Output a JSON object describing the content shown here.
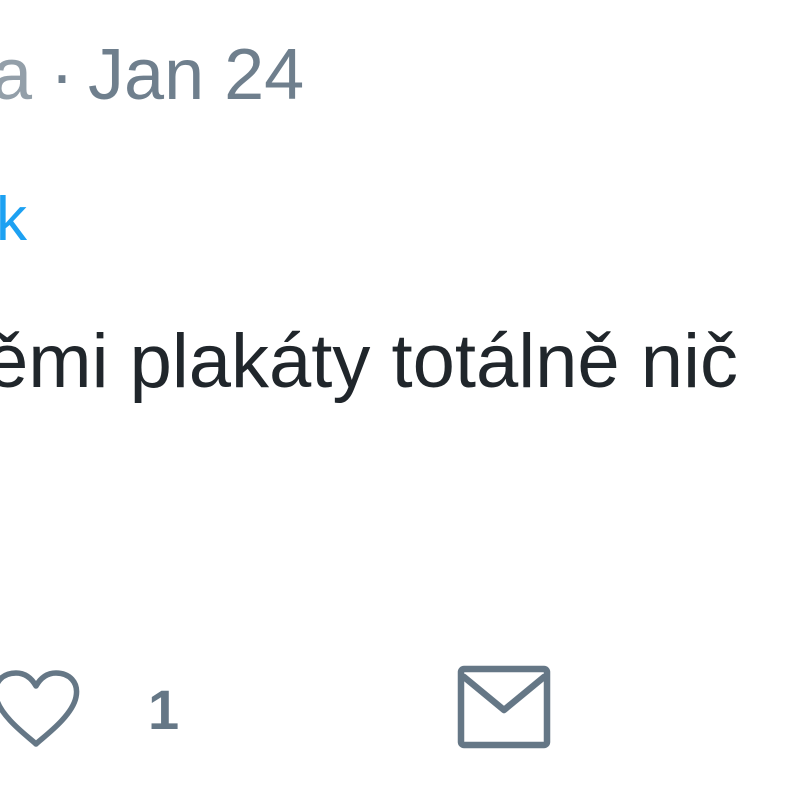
{
  "tweet": {
    "author_fragment": "a",
    "separator": "·",
    "date": "Jan 24",
    "mention_fragment": "k",
    "text_fragment": "ěmi plakáty totálně nič",
    "actions": {
      "like_icon": "heart-icon",
      "like_count": "1",
      "message_icon": "envelope-icon"
    }
  },
  "colors": {
    "meta_text": "#6f7f8d",
    "mention": "#1da1f2",
    "body_text": "#20262b",
    "icon_stroke": "#657786",
    "background": "#ffffff"
  }
}
